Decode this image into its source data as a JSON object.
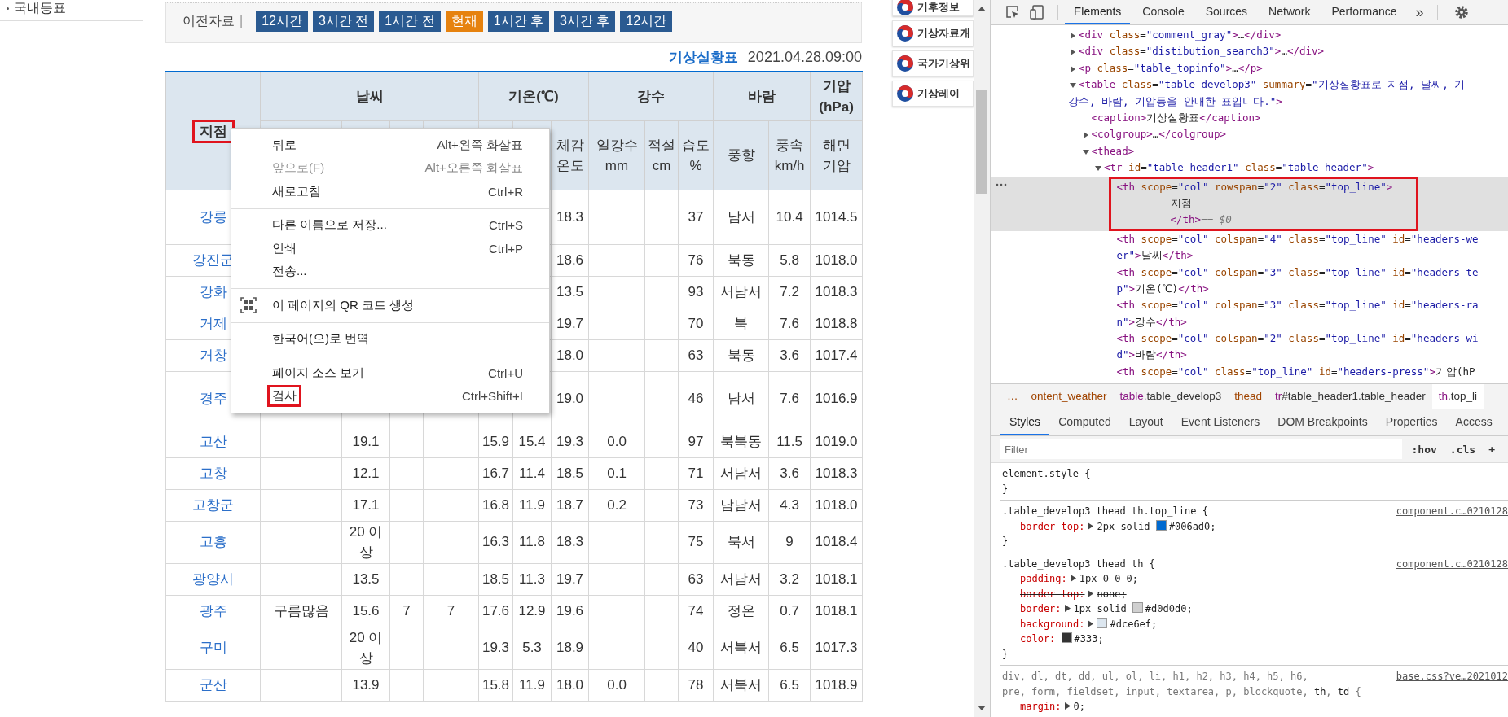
{
  "sidebar": {
    "items": [
      {
        "label": "국내등표"
      }
    ]
  },
  "time_nav": {
    "label": "이전자료",
    "separator": "|",
    "buttons": [
      {
        "label": "12시간",
        "selected": false
      },
      {
        "label": "3시간 전",
        "selected": false
      },
      {
        "label": "1시간 전",
        "selected": false
      },
      {
        "label": "현재",
        "selected": true
      },
      {
        "label": "1시간 후",
        "selected": false
      },
      {
        "label": "3시간 후",
        "selected": false
      },
      {
        "label": "12시간",
        "selected": false
      }
    ]
  },
  "table_caption": {
    "title": "기상실황표",
    "timestamp": "2021.04.28.09:00"
  },
  "table": {
    "station_header": {
      "label": "지점",
      "highlighted": true
    },
    "groups": [
      {
        "lines": [
          "날씨"
        ]
      },
      {
        "lines": [
          "기온(℃)"
        ]
      },
      {
        "lines": [
          "강수"
        ]
      },
      {
        "lines": [
          "바람"
        ]
      },
      {
        "lines": [
          "기압",
          "(hPa)"
        ]
      }
    ],
    "subheaders": [
      {
        "lines": [
          "체감",
          "온도"
        ]
      },
      {
        "lines": [
          "일강수",
          "mm"
        ]
      },
      {
        "lines": [
          "적설",
          "cm"
        ]
      },
      {
        "lines": [
          "습도",
          "%"
        ]
      },
      {
        "lines": [
          "풍향"
        ]
      },
      {
        "lines": [
          "풍속",
          "km/h"
        ]
      },
      {
        "lines": [
          "해면",
          "기압"
        ]
      }
    ],
    "rows": [
      {
        "station": "강릉",
        "tall": true,
        "cells": [
          null,
          null,
          null,
          null,
          null,
          null,
          "18.3",
          null,
          null,
          "37",
          "남서",
          "10.4",
          "1014.5"
        ]
      },
      {
        "station": "강진군",
        "tall": false,
        "cells": [
          null,
          null,
          null,
          null,
          null,
          null,
          "18.6",
          null,
          null,
          "76",
          "북동",
          "5.8",
          "1018.0"
        ]
      },
      {
        "station": "강화",
        "tall": false,
        "cells": [
          null,
          null,
          null,
          null,
          null,
          null,
          "13.5",
          null,
          null,
          "93",
          "서남서",
          "7.2",
          "1018.3"
        ]
      },
      {
        "station": "거제",
        "tall": false,
        "cells": [
          null,
          null,
          null,
          null,
          null,
          null,
          "19.7",
          null,
          null,
          "70",
          "북",
          "7.6",
          "1018.8"
        ]
      },
      {
        "station": "거창",
        "tall": false,
        "cells": [
          null,
          null,
          null,
          null,
          null,
          null,
          "18.0",
          null,
          null,
          "63",
          "북동",
          "3.6",
          "1017.4"
        ]
      },
      {
        "station": "경주",
        "tall": true,
        "cells": [
          null,
          null,
          null,
          null,
          null,
          null,
          "19.0",
          null,
          null,
          "46",
          "남서",
          "7.6",
          "1016.9"
        ]
      },
      {
        "station": "고산",
        "tall": false,
        "cells": [
          null,
          "19.1",
          null,
          null,
          "15.9",
          "15.4",
          "19.3",
          "0.0",
          null,
          "97",
          "북북동",
          "11.5",
          "1019.0"
        ]
      },
      {
        "station": "고창",
        "tall": false,
        "cells": [
          null,
          "12.1",
          null,
          null,
          "16.7",
          "11.4",
          "18.5",
          "0.1",
          null,
          "71",
          "서남서",
          "3.6",
          "1018.3"
        ]
      },
      {
        "station": "고창군",
        "tall": false,
        "cells": [
          null,
          "17.1",
          null,
          null,
          "16.8",
          "11.9",
          "18.7",
          "0.2",
          null,
          "73",
          "남남서",
          "4.3",
          "1018.0"
        ]
      },
      {
        "station": "고흥",
        "tall": false,
        "cells": [
          null,
          "20 이상",
          null,
          null,
          "16.3",
          "11.8",
          "18.3",
          null,
          null,
          "75",
          "북서",
          "9",
          "1018.4"
        ]
      },
      {
        "station": "광양시",
        "tall": false,
        "cells": [
          null,
          "13.5",
          null,
          null,
          "18.5",
          "11.3",
          "19.7",
          null,
          null,
          "63",
          "서남서",
          "3.2",
          "1018.1"
        ]
      },
      {
        "station": "광주",
        "tall": false,
        "cells": [
          "구름많음",
          "15.6",
          "7",
          "7",
          "17.6",
          "12.9",
          "19.6",
          null,
          null,
          "74",
          "정온",
          "0.7",
          "1018.1"
        ]
      },
      {
        "station": "구미",
        "tall": false,
        "cells": [
          null,
          "20 이상",
          null,
          null,
          "19.3",
          "5.3",
          "18.9",
          null,
          null,
          "40",
          "서북서",
          "6.5",
          "1017.3"
        ]
      },
      {
        "station": "군산",
        "tall": false,
        "cells": [
          null,
          "13.9",
          null,
          null,
          "15.8",
          "11.9",
          "18.0",
          "0.0",
          null,
          "78",
          "서북서",
          "6.5",
          "1018.9"
        ]
      }
    ]
  },
  "context_menu": {
    "groups": [
      [
        {
          "label": "뒤로",
          "shortcut": "Alt+왼쪽 화살표",
          "disabled": false,
          "highlighted": false,
          "kind": "plain"
        },
        {
          "label": "앞으로(F)",
          "shortcut": "Alt+오른쪽 화살표",
          "disabled": true,
          "highlighted": false,
          "kind": "plain"
        },
        {
          "label": "새로고침",
          "shortcut": "Ctrl+R",
          "disabled": false,
          "highlighted": false,
          "kind": "plain"
        }
      ],
      [
        {
          "label": "다른 이름으로 저장...",
          "shortcut": "Ctrl+S",
          "disabled": false,
          "highlighted": false,
          "kind": "plain"
        },
        {
          "label": "인쇄",
          "shortcut": "Ctrl+P",
          "disabled": false,
          "highlighted": false,
          "kind": "plain"
        },
        {
          "label": "전송...",
          "disabled": false,
          "highlighted": false,
          "kind": "plain"
        }
      ],
      [
        {
          "label": "이 페이지의 QR 코드 생성",
          "disabled": false,
          "highlighted": false,
          "kind": "qr"
        }
      ],
      [
        {
          "label": "한국어(으)로 번역",
          "disabled": false,
          "highlighted": false,
          "kind": "plain"
        }
      ],
      [
        {
          "label": "페이지 소스 보기",
          "shortcut": "Ctrl+U",
          "disabled": false,
          "highlighted": false,
          "kind": "plain"
        },
        {
          "label": "검사",
          "shortcut": "Ctrl+Shift+I",
          "disabled": false,
          "highlighted": true,
          "kind": "plain"
        }
      ]
    ]
  },
  "side_banners": [
    {
      "label": "기후정보"
    },
    {
      "label": "기상자료개"
    },
    {
      "label": "국가기상위"
    },
    {
      "label": "기상레이"
    }
  ],
  "devtools": {
    "tabs": [
      {
        "label": "Elements",
        "selected": true
      },
      {
        "label": "Console",
        "selected": false
      },
      {
        "label": "Sources",
        "selected": false
      },
      {
        "label": "Network",
        "selected": false
      },
      {
        "label": "Performance",
        "selected": false
      }
    ],
    "more": "»",
    "dom": [
      {
        "text": "<div class=\"comment_gray\">…</div>",
        "expanded": false,
        "selected": false
      },
      {
        "text": "<div class=\"distibution_search3\">…</div>",
        "expanded": false,
        "selected": false
      },
      {
        "text": "<p class=\"table_topinfo\">…</p>",
        "expanded": false,
        "selected": false
      },
      {
        "text": "<table class=\"table_develop3\" summary=\"기상실황표로 지점, 날씨, 기",
        "continuation": "강수, 바람, 기압등을 안내한 표입니다.\">",
        "expanded": true,
        "selected": false,
        "children": [
          {
            "text": "<caption>기상실황표</caption>",
            "selected": false
          },
          {
            "text": "<colgroup>…</colgroup>",
            "expanded": false,
            "selected": false
          },
          {
            "text": "<thead>",
            "expanded": true,
            "selected": false,
            "children": [
              {
                "text": "<tr id=\"table_header1\" class=\"table_header\">",
                "expanded": true,
                "selected": false,
                "children": [
                  {
                    "text": "<th scope=\"col\" rowspan=\"2\" class=\"top_line\">",
                    "content": "지점",
                    "closing": "</th>",
                    "console_ref": "== $0",
                    "selected": true,
                    "highlighted": true
                  },
                  {
                    "text": "<th scope=\"col\" colspan=\"4\" class=\"top_line\" id=\"headers-we",
                    "continuation": "er\">날씨</th>",
                    "selected": false
                  },
                  {
                    "text": "<th scope=\"col\" colspan=\"3\" class=\"top_line\" id=\"headers-te",
                    "continuation": "p\">기온(℃)</th>",
                    "selected": false
                  },
                  {
                    "text": "<th scope=\"col\" colspan=\"3\" class=\"top_line\" id=\"headers-ra",
                    "continuation": "n\">강수</th>",
                    "selected": false
                  },
                  {
                    "text": "<th scope=\"col\" colspan=\"2\" class=\"top_line\" id=\"headers-wi",
                    "continuation": "d\">바람</th>",
                    "selected": false
                  },
                  {
                    "text": "<th scope=\"col\" class=\"top_line\" id=\"headers-press\">기압(hP",
                    "selected": false
                  }
                ]
              }
            ]
          }
        ]
      }
    ],
    "breadcrumbs": [
      {
        "label": "…",
        "selected": false
      },
      {
        "label": "ontent_weather",
        "selected": false
      },
      {
        "label": "table.table_develop3",
        "selected": false
      },
      {
        "label": "thead",
        "selected": false
      },
      {
        "label": "tr#table_header1.table_header",
        "selected": false
      },
      {
        "label": "th.top_li",
        "selected": true
      }
    ],
    "pane_tabs": [
      {
        "label": "Styles",
        "selected": true
      },
      {
        "label": "Computed",
        "selected": false
      },
      {
        "label": "Layout",
        "selected": false
      },
      {
        "label": "Event Listeners",
        "selected": false
      },
      {
        "label": "DOM Breakpoints",
        "selected": false
      },
      {
        "label": "Properties",
        "selected": false
      },
      {
        "label": "Access",
        "selected": false
      }
    ],
    "filter": {
      "placeholder": "Filter",
      "buttons": [
        ":hov",
        ".cls",
        "+"
      ]
    },
    "rules": [
      {
        "selector_lines": [
          "element.style {"
        ],
        "closing": "}"
      },
      {
        "selector_lines": [
          ".table_develop3 thead th.top_line {"
        ],
        "source": "component.c…0210128",
        "closing": "}",
        "declarations": [
          {
            "property": "border-top:",
            "value": "2px solid #006ad0;",
            "swatch": true,
            "expandable": true,
            "struck": false
          }
        ]
      },
      {
        "selector_lines": [
          ".table_develop3 thead th {"
        ],
        "source": "component.c…0210128",
        "closing": "}",
        "declarations": [
          {
            "property": "padding:",
            "value": "1px 0 0 0;",
            "swatch": false,
            "expandable": true,
            "struck": false
          },
          {
            "property": "border-top:",
            "value": "none;",
            "swatch": false,
            "expandable": true,
            "struck": true
          },
          {
            "property": "border:",
            "value": "1px solid #d0d0d0;",
            "swatch": true,
            "expandable": true,
            "struck": false
          },
          {
            "property": "background:",
            "value": "#dce6ef;",
            "swatch": true,
            "expandable": true,
            "struck": false
          },
          {
            "property": "color:",
            "value": "#333;",
            "swatch": true,
            "expandable": false,
            "struck": false
          }
        ]
      },
      {
        "selector_lines": [
          "div, dl, dt, dd, ul, ol, li, h1, h2, h3, h4, h5, h6,",
          "pre, form, fieldset, input, textarea, p, blockquote, **th**, **td** {"
        ],
        "source": "base.css?ve…2021012",
        "declarations": [
          {
            "property": "margin:",
            "value": "0;",
            "swatch": false,
            "expandable": true,
            "struck": false
          }
        ]
      }
    ]
  }
}
